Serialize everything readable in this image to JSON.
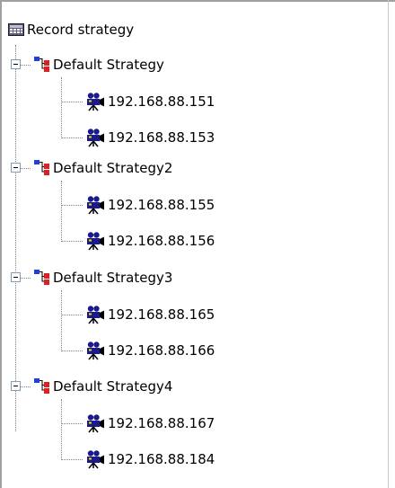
{
  "tree": {
    "root": {
      "label": "Record strategy",
      "icon": "record-strategy-icon"
    },
    "strategies": [
      {
        "label": "Default Strategy",
        "icon": "strategy-icon",
        "expanded": true,
        "devices": [
          {
            "label": "192.168.88.151",
            "icon": "camera-icon"
          },
          {
            "label": "192.168.88.153",
            "icon": "camera-icon"
          }
        ]
      },
      {
        "label": "Default Strategy2",
        "icon": "strategy-icon",
        "expanded": true,
        "devices": [
          {
            "label": "192.168.88.155",
            "icon": "camera-icon"
          },
          {
            "label": "192.168.88.156",
            "icon": "camera-icon"
          }
        ]
      },
      {
        "label": "Default Strategy3",
        "icon": "strategy-icon",
        "expanded": true,
        "devices": [
          {
            "label": "192.168.88.165",
            "icon": "camera-icon"
          },
          {
            "label": "192.168.88.166",
            "icon": "camera-icon"
          }
        ]
      },
      {
        "label": "Default Strategy4",
        "icon": "strategy-icon",
        "expanded": true,
        "devices": [
          {
            "label": "192.168.88.167",
            "icon": "camera-icon"
          },
          {
            "label": "192.168.88.184",
            "icon": "camera-icon"
          }
        ]
      }
    ]
  }
}
